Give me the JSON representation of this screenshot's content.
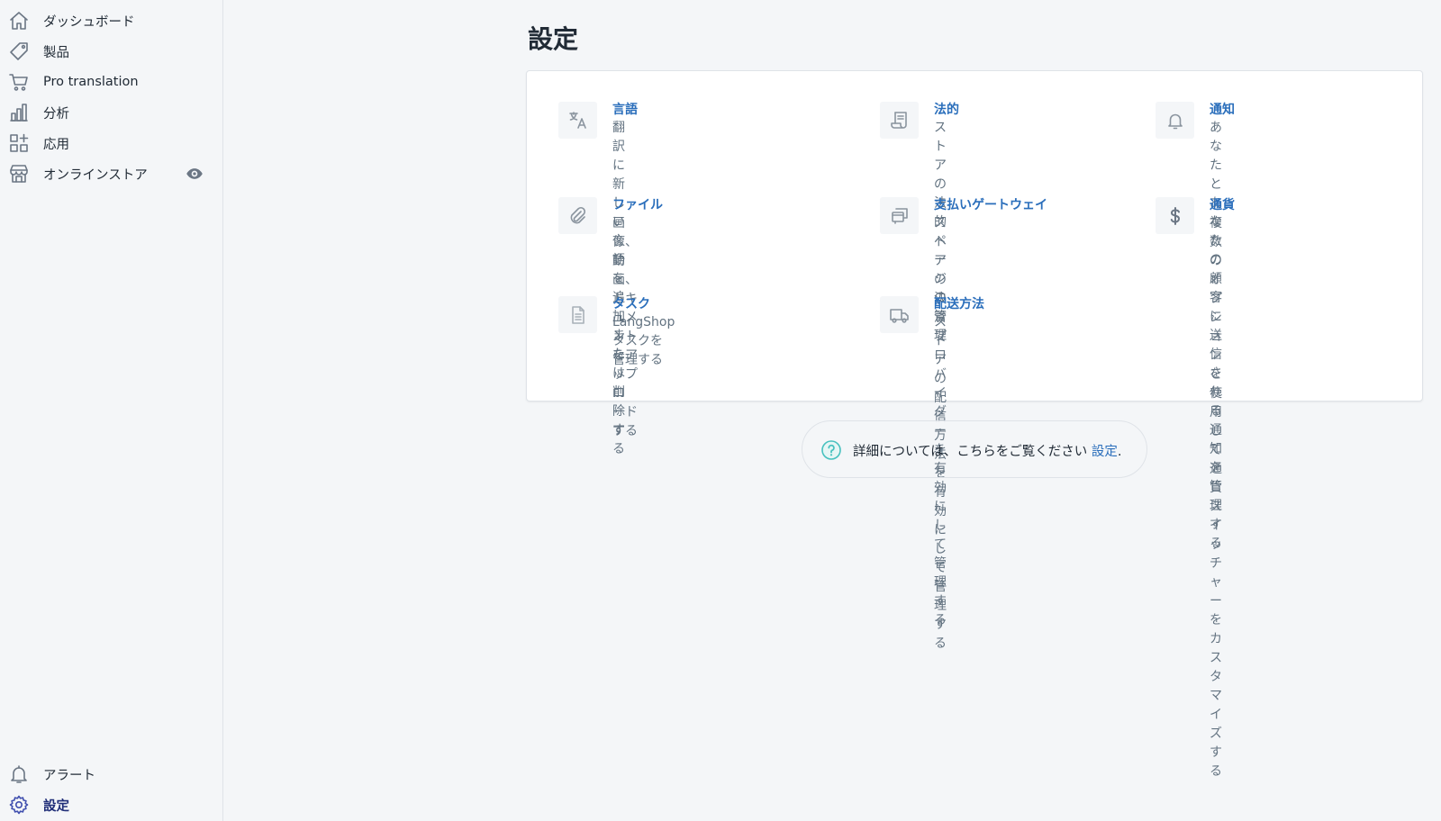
{
  "sidebar": {
    "top_items": [
      {
        "label": "ダッシュボード",
        "icon": "home-icon"
      },
      {
        "label": "製品",
        "icon": "tag-icon"
      },
      {
        "label": "Pro translation",
        "icon": "cart-icon"
      },
      {
        "label": "分析",
        "icon": "bar-chart-icon"
      },
      {
        "label": "応用",
        "icon": "apps-icon"
      },
      {
        "label": "オンラインストア",
        "icon": "store-icon",
        "extra_icon": "eye-icon"
      }
    ],
    "bottom_items": [
      {
        "label": "アラート",
        "icon": "bell-icon"
      },
      {
        "label": "設定",
        "icon": "gear-icon",
        "active": true
      }
    ]
  },
  "page": {
    "title": "設定"
  },
  "settings": [
    {
      "title": "言語",
      "desc_lines": [
        "翻訳に新しい言語を追加または削除す",
        "る"
      ],
      "icon": "translate-icon"
    },
    {
      "title": "法的",
      "desc_lines": [
        "ストアの法的ページの管理"
      ],
      "icon": "legal-scroll-icon"
    },
    {
      "title": "通知",
      "desc_lines": [
        "あなたとあなたの顧客に送信",
        "される通知を管理する"
      ],
      "icon": "bell-icon"
    },
    {
      "title": "ファイル",
      "desc_lines": [
        "画像、動画、ドキュメントをアップロ",
        "ードする"
      ],
      "icon": "paperclip-icon"
    },
    {
      "title": "支払いゲートウェイ",
      "desc_lines": [
        "ストアの決済プロバイダーを",
        "有効にして管理する"
      ],
      "icon": "payment-cards-icon"
    },
    {
      "title": "通貨",
      "desc_lines": [
        "複数のオプションを使用して",
        "通貨スイッチャーをカスタマ",
        "イズする"
      ],
      "icon": "dollar-icon"
    },
    {
      "title": "タスク",
      "desc_lines": [
        "LangShopタスクを管理する"
      ],
      "icon": "task-document-icon"
    },
    {
      "title": "配送方法",
      "desc_lines": [
        "ストアの配信方法を有効にし",
        "て管理する"
      ],
      "icon": "truck-icon"
    }
  ],
  "help": {
    "text": "詳細については、こちらをご覧ください",
    "link": "設定",
    "suffix": ".",
    "icon": "question-circle-icon",
    "icon_color": "#47c1bf"
  },
  "colors": {
    "link": "#2a6ebb",
    "active_nav": "#202e78",
    "background": "#f4f6f8"
  }
}
